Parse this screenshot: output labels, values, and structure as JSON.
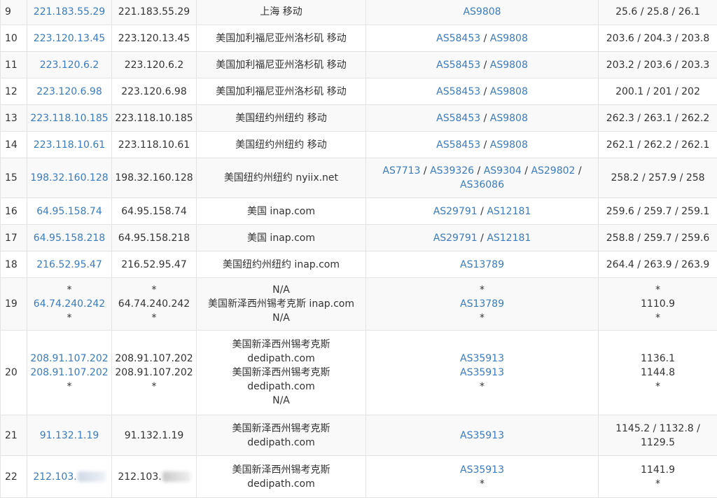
{
  "rows": [
    {
      "hop": "9",
      "ips": [
        "221.183.55.29"
      ],
      "hosts": [
        "221.183.55.29"
      ],
      "locations": [
        "上海 移动"
      ],
      "asn": [
        [
          "AS9808"
        ]
      ],
      "times": [
        "25.6 / 25.8 / 26.1"
      ]
    },
    {
      "hop": "10",
      "ips": [
        "223.120.13.45"
      ],
      "hosts": [
        "223.120.13.45"
      ],
      "locations": [
        "美国加利福尼亚州洛杉矶 移动"
      ],
      "asn": [
        [
          "AS58453",
          "AS9808"
        ]
      ],
      "times": [
        "203.6 / 204.3 / 203.8"
      ]
    },
    {
      "hop": "11",
      "ips": [
        "223.120.6.2"
      ],
      "hosts": [
        "223.120.6.2"
      ],
      "locations": [
        "美国加利福尼亚州洛杉矶 移动"
      ],
      "asn": [
        [
          "AS58453",
          "AS9808"
        ]
      ],
      "times": [
        "203.2 / 203.6 / 203.3"
      ]
    },
    {
      "hop": "12",
      "ips": [
        "223.120.6.98"
      ],
      "hosts": [
        "223.120.6.98"
      ],
      "locations": [
        "美国加利福尼亚州洛杉矶 移动"
      ],
      "asn": [
        [
          "AS58453",
          "AS9808"
        ]
      ],
      "times": [
        "200.1 / 201 / 202"
      ]
    },
    {
      "hop": "13",
      "ips": [
        "223.118.10.185"
      ],
      "hosts": [
        "223.118.10.185"
      ],
      "locations": [
        "美国纽约州纽约 移动"
      ],
      "asn": [
        [
          "AS58453",
          "AS9808"
        ]
      ],
      "times": [
        "262.3 / 263.1 / 262.2"
      ]
    },
    {
      "hop": "14",
      "ips": [
        "223.118.10.61"
      ],
      "hosts": [
        "223.118.10.61"
      ],
      "locations": [
        "美国纽约州纽约 移动"
      ],
      "asn": [
        [
          "AS58453",
          "AS9808"
        ]
      ],
      "times": [
        "262.1 / 262.2 / 262.1"
      ]
    },
    {
      "hop": "15",
      "ips": [
        "198.32.160.128"
      ],
      "hosts": [
        "198.32.160.128"
      ],
      "locations": [
        "美国纽约州纽约 nyiix.net"
      ],
      "asn": [
        [
          "AS7713",
          "AS39326",
          "AS9304",
          "AS29802",
          "AS36086"
        ]
      ],
      "times": [
        "258.2 / 257.9 / 258"
      ]
    },
    {
      "hop": "16",
      "ips": [
        "64.95.158.74"
      ],
      "hosts": [
        "64.95.158.74"
      ],
      "locations": [
        "美国 inap.com"
      ],
      "asn": [
        [
          "AS29791",
          "AS12181"
        ]
      ],
      "times": [
        "259.6 / 259.7 / 259.1"
      ]
    },
    {
      "hop": "17",
      "ips": [
        "64.95.158.218"
      ],
      "hosts": [
        "64.95.158.218"
      ],
      "locations": [
        "美国 inap.com"
      ],
      "asn": [
        [
          "AS29791",
          "AS12181"
        ]
      ],
      "times": [
        "258.8 / 259.7 / 259.6"
      ]
    },
    {
      "hop": "18",
      "ips": [
        "216.52.95.47"
      ],
      "hosts": [
        "216.52.95.47"
      ],
      "locations": [
        "美国纽约州纽约 inap.com"
      ],
      "asn": [
        [
          "AS13789"
        ]
      ],
      "times": [
        "264.4 / 263.9 / 263.9"
      ]
    },
    {
      "hop": "19",
      "ips": [
        "*",
        "64.74.240.242",
        "*"
      ],
      "hosts": [
        "*",
        "64.74.240.242",
        "*"
      ],
      "locations": [
        "N/A",
        "美国新泽西州锡考克斯 inap.com",
        "N/A"
      ],
      "asn": [
        [
          "*"
        ],
        [
          "AS13789"
        ],
        [
          "*"
        ]
      ],
      "times": [
        "*",
        "1110.9",
        "*"
      ]
    },
    {
      "hop": "20",
      "ips": [
        "208.91.107.202",
        "208.91.107.202",
        "*"
      ],
      "hosts": [
        "208.91.107.202",
        "208.91.107.202",
        "*"
      ],
      "locations": [
        "美国新泽西州锡考克斯 dedipath.com",
        "美国新泽西州锡考克斯 dedipath.com",
        "N/A"
      ],
      "asn": [
        [
          "AS35913"
        ],
        [
          "AS35913"
        ],
        [
          "*"
        ]
      ],
      "times": [
        "1136.1",
        "1144.8",
        "*"
      ]
    },
    {
      "hop": "21",
      "ips": [
        "91.132.1.19"
      ],
      "hosts": [
        "91.132.1.19"
      ],
      "locations": [
        "美国新泽西州锡考克斯 dedipath.com"
      ],
      "asn": [
        [
          "AS35913"
        ]
      ],
      "times": [
        "1145.2 / 1132.8 / 1129.5"
      ]
    },
    {
      "hop": "22",
      "ips": [
        "212.103."
      ],
      "hosts": [
        "212.103."
      ],
      "locations": [
        "美国新泽西州锡考克斯 dedipath.com"
      ],
      "asn": [
        [
          "AS35913"
        ],
        [
          "*"
        ]
      ],
      "times": [
        "1141.9",
        "*"
      ],
      "redacted": true
    }
  ]
}
